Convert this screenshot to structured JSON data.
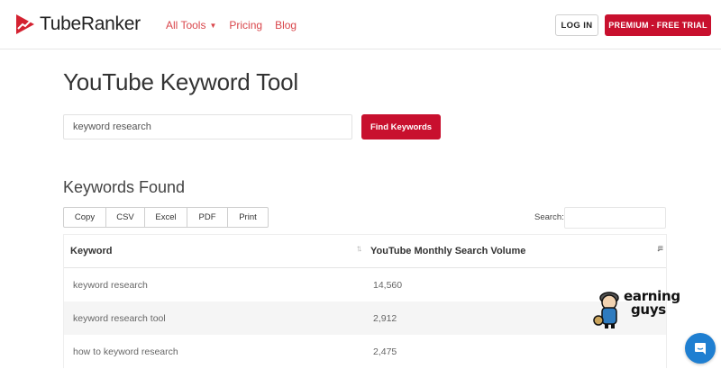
{
  "header": {
    "logo_text": "TubeRanker",
    "nav": [
      {
        "label": "All Tools",
        "has_caret": true
      },
      {
        "label": "Pricing"
      },
      {
        "label": "Blog"
      }
    ],
    "login_label": "LOG IN",
    "premium_label": "PREMIUM - FREE TRIAL"
  },
  "main": {
    "title": "YouTube Keyword Tool",
    "search": {
      "value": "keyword research"
    },
    "find_button": "Find Keywords",
    "results_title": "Keywords Found",
    "export_buttons": [
      "Copy",
      "CSV",
      "Excel",
      "PDF",
      "Print"
    ],
    "table_search_label": "Search:",
    "table": {
      "columns": [
        "Keyword",
        "YouTube Monthly Search Volume"
      ],
      "rows": [
        {
          "keyword": "keyword research",
          "volume": "14,560"
        },
        {
          "keyword": "keyword research tool",
          "volume": "2,912"
        },
        {
          "keyword": "how to keyword research",
          "volume": "2,475"
        }
      ]
    }
  },
  "watermark": {
    "line1": "earning",
    "line2": "guys"
  },
  "colors": {
    "brand_red": "#c8102e",
    "nav_red": "#d9464b",
    "chat_blue": "#1f7fd1"
  },
  "icons": {
    "logo": "play-trend-icon",
    "caret": "caret-down-icon",
    "sort": "sort-icon",
    "chat": "chat-icon"
  }
}
